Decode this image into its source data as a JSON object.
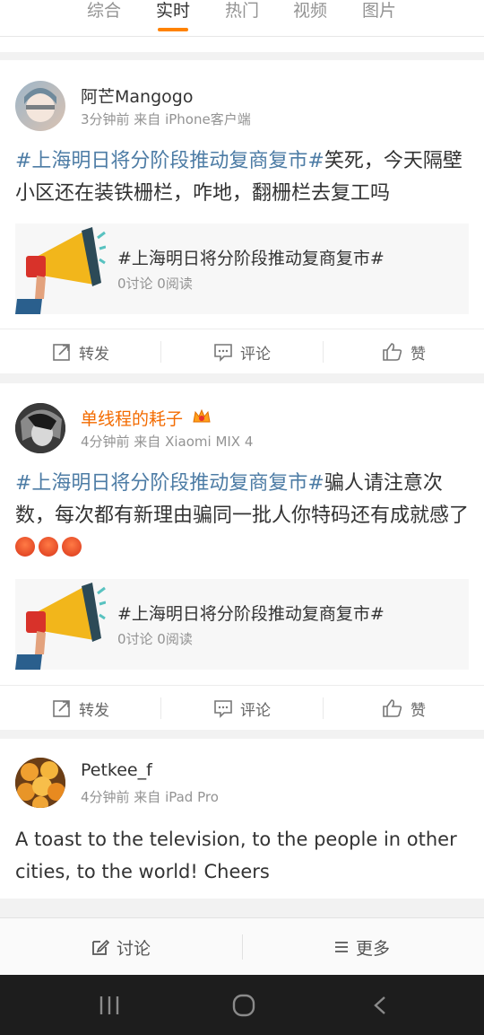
{
  "tabs": [
    "综合",
    "实时",
    "热门",
    "视频",
    "图片"
  ],
  "posts": [
    {
      "username": "阿芒Mangogo",
      "meta": "3分钟前 来自 iPhone客户端",
      "topic": "#上海明日将分阶段推动复商复市#",
      "text": "笑死，今天隔壁小区还在装铁栅栏，咋地，翻栅栏去复工吗",
      "card": {
        "title": "#上海明日将分阶段推动复商复市#",
        "stats": "0讨论 0阅读"
      }
    },
    {
      "username": "单线程的耗子",
      "meta": "4分钟前 来自 Xiaomi MIX 4",
      "topic": "#上海明日将分阶段推动复商复市#",
      "text": "骗人请注意次数，每次都有新理由骗同一批人你特码还有成就感了",
      "card": {
        "title": "#上海明日将分阶段推动复商复市#",
        "stats": "0讨论 0阅读"
      }
    },
    {
      "username": "Petkee_f",
      "meta": "4分钟前 来自 iPad Pro",
      "text": "A toast to the television, to the people in other cities, to the world! Cheers"
    }
  ],
  "actions": {
    "repost": "转发",
    "comment": "评论",
    "like": "赞"
  },
  "bottom_bar": {
    "discuss": "讨论",
    "more": "更多"
  },
  "icons": {
    "repost": "repost-icon",
    "comment": "comment-icon",
    "like": "thumbs-up-icon",
    "edit": "edit-icon",
    "menu": "menu-icon",
    "crown": "crown-badge-icon",
    "megaphone": "megaphone-icon",
    "emoji": "angry-face-icon"
  },
  "colors": {
    "accent": "#ff8200",
    "topic": "#4d7ca5",
    "vip_name": "#f36b00"
  }
}
